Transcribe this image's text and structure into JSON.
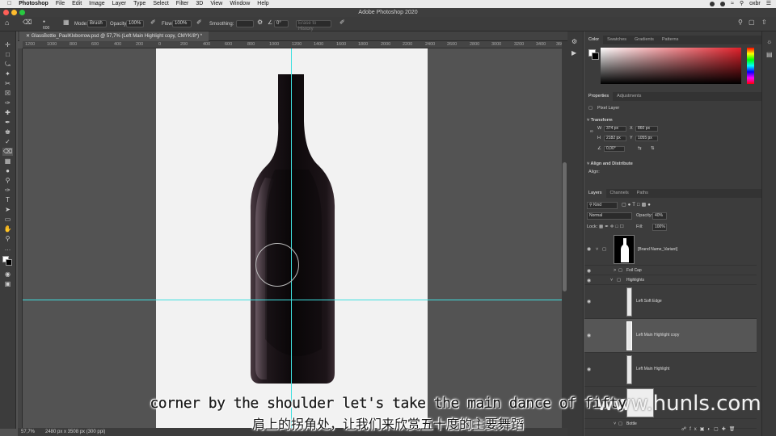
{
  "menubar": {
    "app": "Photoshop",
    "items": [
      "File",
      "Edit",
      "Image",
      "Layer",
      "Type",
      "Select",
      "Filter",
      "3D",
      "View",
      "Window",
      "Help"
    ],
    "user": "oxbr"
  },
  "window": {
    "title": "Adobe Photoshop 2020"
  },
  "options": {
    "brush_size": "600",
    "mode_label": "Mode:",
    "mode_value": "Brush",
    "opacity_label": "Opacity:",
    "opacity_value": "100%",
    "flow_label": "Flow:",
    "flow_value": "100%",
    "smoothing_label": "Smoothing:",
    "angle_value": "0°",
    "erase_history": "Erase to History"
  },
  "document": {
    "tab_label": "GlassBottle_PaulKlxborrow.psd @ 57,7% (Left Main Highlight copy, CMYK/8*) *"
  },
  "ruler": {
    "ticks": [
      "1200",
      "1000",
      "800",
      "600",
      "400",
      "200",
      "0",
      "200",
      "400",
      "600",
      "800",
      "1000",
      "1200",
      "1400",
      "1600",
      "1800",
      "2000",
      "2200",
      "2400",
      "2600",
      "2800",
      "3000",
      "3200",
      "3400",
      "3600"
    ]
  },
  "status": {
    "zoom": "57,7%",
    "doc_info": "2480 px x 3508 px (300 ppi)"
  },
  "color_panel": {
    "tabs": [
      "Color",
      "Swatches",
      "Gradients",
      "Patterns"
    ]
  },
  "properties": {
    "tabs": [
      "Properties",
      "Adjustments"
    ],
    "kind": "Pixel Layer",
    "transform_label": "Transform",
    "w_label": "W",
    "w_value": "374 px",
    "x_label": "X",
    "x_value": "860 px",
    "h_label": "H",
    "h_value": "2182 px",
    "y_label": "Y",
    "y_value": "1055 px",
    "angle_value": "0,00°",
    "align_label": "Align and Distribute",
    "align_sub": "Align:"
  },
  "layers_panel": {
    "tabs": [
      "Layers",
      "Channels",
      "Paths"
    ],
    "filter_kind": "Kind",
    "blend_mode": "Normal",
    "opacity_label": "Opacity:",
    "opacity_value": "40%",
    "lock_label": "Lock:",
    "fill_label": "Fill:",
    "fill_value": "100%",
    "layers": [
      {
        "name": "[Brand Name_Variant]"
      },
      {
        "name": "Foil Cap"
      },
      {
        "name": "Highlights"
      },
      {
        "name": "Left Soft Edge"
      },
      {
        "name": "Left Main Highlight copy"
      },
      {
        "name": "Left Main Highlight"
      },
      {
        "name": "Bottle"
      }
    ]
  },
  "subtitles": {
    "en": "corner by the shoulder let's take the main dance of fifty",
    "zh": "肩上的拐角处，让我们来欣赏五十度的主要舞蹈"
  },
  "watermark": "www.hunls.com"
}
